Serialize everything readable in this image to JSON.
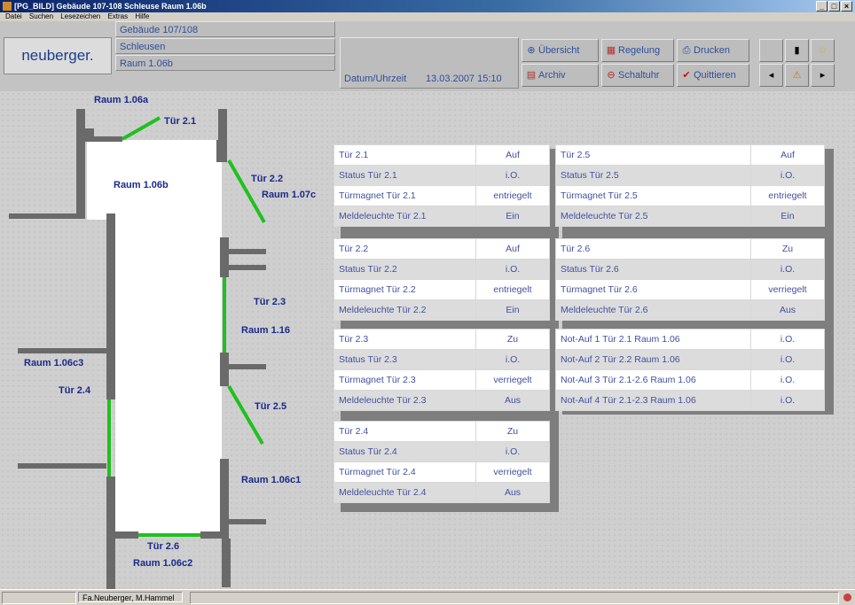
{
  "window": {
    "title": "[PG_BILD] Gebäude 107-108 Schleuse Raum 1.06b"
  },
  "menu": [
    "Datei",
    "Suchen",
    "Lesezeichen",
    "Extras",
    "Hilfe"
  ],
  "header": {
    "logo": "neuberger.",
    "location": [
      "Gebäude 107/108",
      "Schleusen",
      "Raum 1.06b"
    ],
    "datetime_label": "Datum/Uhrzeit",
    "datetime_value": "13.03.2007 15:10",
    "buttons": {
      "uebersicht": "Übersicht",
      "regelung": "Regelung",
      "drucken": "Drucken",
      "archiv": "Archiv",
      "schaltuhr": "Schaltuhr",
      "quittieren": "Quittieren"
    }
  },
  "plan": {
    "labels": [
      "Raum 1.06a",
      "Tür 2.1",
      "Raum 1.06b",
      "Tür 2.2",
      "Raum 1.07c",
      "Tür 2.3",
      "Raum 1.16",
      "Raum 1.06c3",
      "Tür 2.4",
      "Tür 2.5",
      "Raum 1.06c1",
      "Tür 2.6",
      "Raum 1.06c2"
    ],
    "colors": {
      "door_open": "#20c020",
      "wall": "#6a6a6a",
      "room": "#ffffff"
    }
  },
  "tables": {
    "left": [
      [
        [
          "Tür 2.1",
          "Auf"
        ],
        [
          "Status Tür 2.1",
          "i.O."
        ],
        [
          "Türmagnet Tür 2.1",
          "entriegelt"
        ],
        [
          "Meldeleuchte Tür 2.1",
          "Ein"
        ]
      ],
      [
        [
          "Tür 2.2",
          "Auf"
        ],
        [
          "Status Tür 2.2",
          "i.O."
        ],
        [
          "Türmagnet Tür 2.2",
          "entriegelt"
        ],
        [
          "Meldeleuchte Tür 2.2",
          "Ein"
        ]
      ],
      [
        [
          "Tür 2.3",
          "Zu"
        ],
        [
          "Status Tür 2.3",
          "i.O."
        ],
        [
          "Türmagnet Tür 2.3",
          "verriegelt"
        ],
        [
          "Meldeleuchte Tür 2.3",
          "Aus"
        ]
      ],
      [
        [
          "Tür 2.4",
          "Zu"
        ],
        [
          "Status Tür 2.4",
          "i.O."
        ],
        [
          "Türmagnet Tür 2.4",
          "verriegelt"
        ],
        [
          "Meldeleuchte Tür 2.4",
          "Aus"
        ]
      ]
    ],
    "right": [
      [
        [
          "Tür 2.5",
          "Auf"
        ],
        [
          "Status Tür 2.5",
          "i.O."
        ],
        [
          "Türmagnet Tür 2.5",
          "entriegelt"
        ],
        [
          "Meldeleuchte Tür 2.5",
          "Ein"
        ]
      ],
      [
        [
          "Tür 2.6",
          "Zu"
        ],
        [
          "Status Tür 2.6",
          "i.O."
        ],
        [
          "Türmagnet Tür 2.6",
          "verriegelt"
        ],
        [
          "Meldeleuchte Tür 2.6",
          "Aus"
        ]
      ],
      [
        [
          "Not-Auf 1 Tür 2.1 Raum 1.06",
          "i.O."
        ],
        [
          "Not-Auf 2 Tür 2.2 Raum 1.06",
          "i.O."
        ],
        [
          "Not-Auf 3 Tür 2.1-2.6 Raum 1.06",
          "i.O."
        ],
        [
          "Not-Auf 4 Tür 2.1-2.3 Raum 1.06",
          "i.O."
        ]
      ]
    ]
  },
  "status": {
    "user": "Fa.Neuberger, M.Hammel"
  }
}
